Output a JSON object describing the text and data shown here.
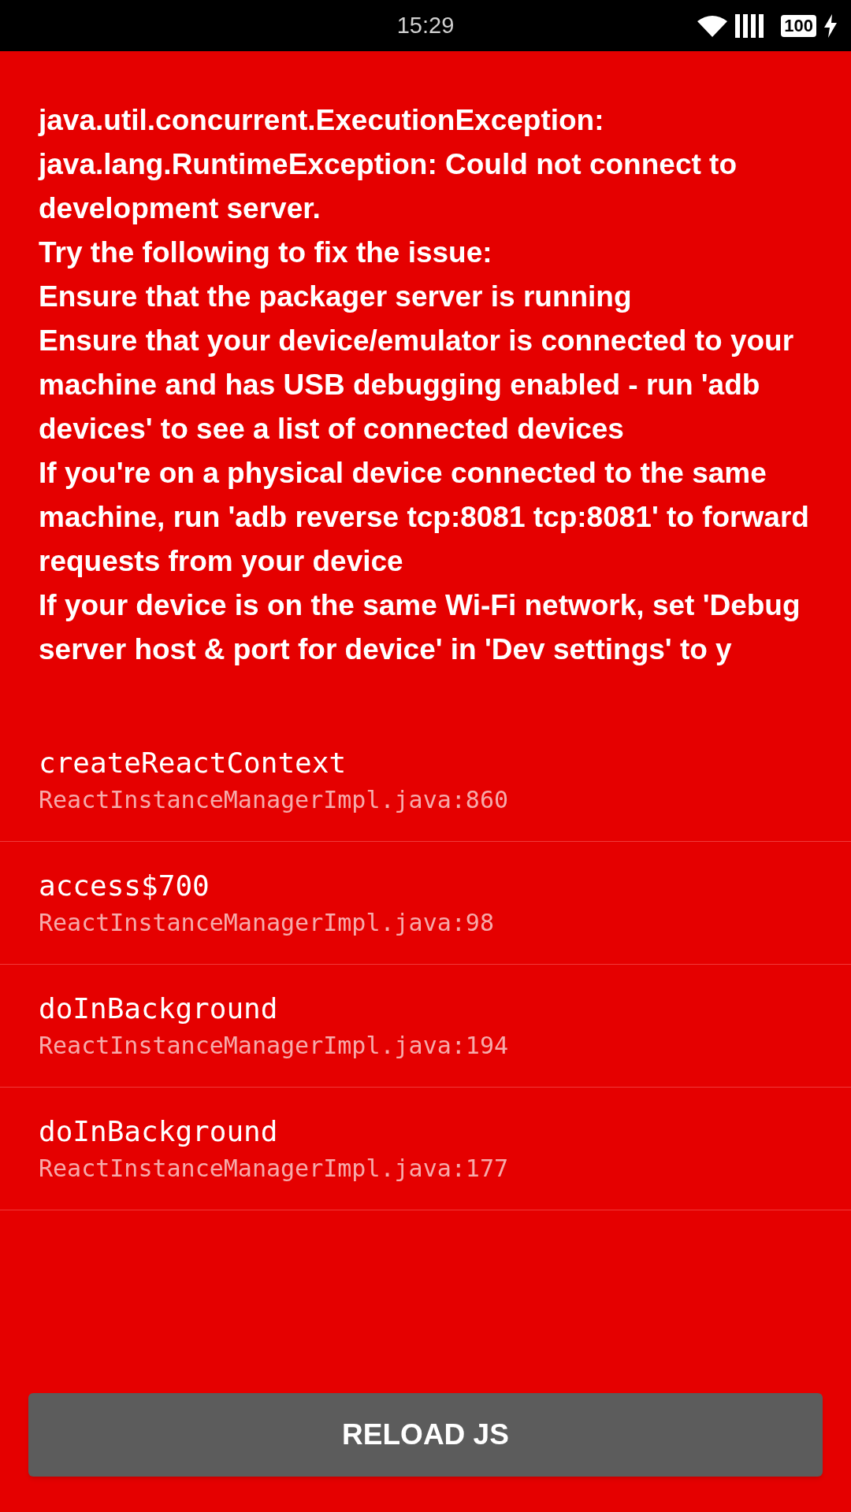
{
  "status_bar": {
    "time": "15:29",
    "battery": "100"
  },
  "message_lines": [
    "java.util.concurrent.ExecutionException: java.lang.RuntimeException: Could not connect to development server.",
    "Try the following to fix the issue:",
    "Ensure that the packager server is running",
    "Ensure that your device/emulator is connected to your machine and has USB debugging enabled - run 'adb devices' to see a list of connected devices",
    "If you're on a physical device connected to the same machine, run 'adb reverse tcp:8081 tcp:8081' to forward requests from your device",
    "If your device is on the same Wi-Fi network, set 'Debug server host & port for device' in 'Dev settings' to y"
  ],
  "stack_frames": [
    {
      "method": "createReactContext",
      "location": "ReactInstanceManagerImpl.java:860"
    },
    {
      "method": "access$700",
      "location": "ReactInstanceManagerImpl.java:98"
    },
    {
      "method": "doInBackground",
      "location": "ReactInstanceManagerImpl.java:194"
    },
    {
      "method": "doInBackground",
      "location": "ReactInstanceManagerImpl.java:177"
    }
  ],
  "reload_button": "RELOAD JS"
}
